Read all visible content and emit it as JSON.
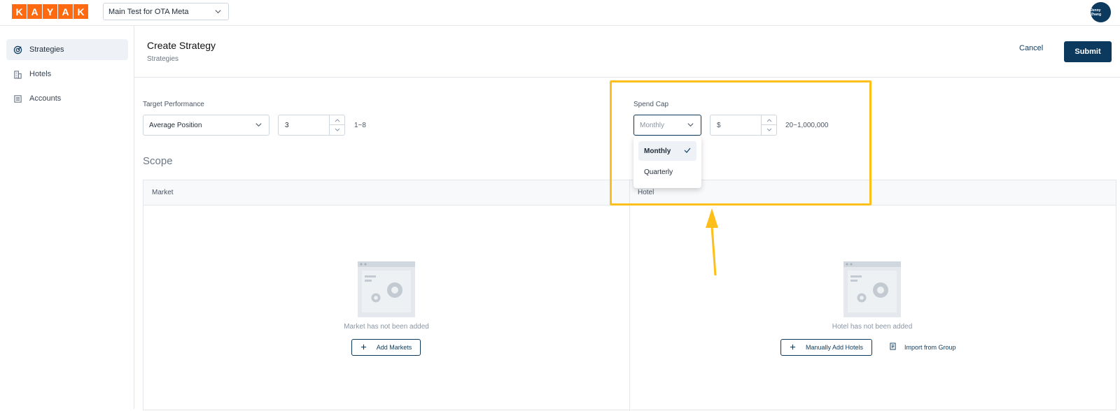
{
  "brand": {
    "letters": [
      "K",
      "A",
      "Y",
      "A",
      "K"
    ],
    "color": "#ff690f"
  },
  "account_selector": {
    "value": "Main Test for OTA Meta"
  },
  "user": {
    "initials": "Jenny Zhang"
  },
  "sidebar": {
    "items": [
      {
        "label": "Strategies",
        "icon": "target-icon",
        "active": true
      },
      {
        "label": "Hotels",
        "icon": "building-icon",
        "active": false
      },
      {
        "label": "Accounts",
        "icon": "ledger-icon",
        "active": false
      }
    ]
  },
  "header": {
    "title": "Create Strategy",
    "breadcrumb": "Strategies",
    "cancel_label": "Cancel",
    "submit_label": "Submit"
  },
  "target_performance": {
    "label": "Target Performance",
    "metric_value": "Average Position",
    "number_value": "3",
    "range_hint": "1~8"
  },
  "spend_cap": {
    "label": "Spend Cap",
    "period_placeholder": "Monthly",
    "currency_symbol": "$",
    "amount_value": "",
    "range_hint": "20~1,000,000",
    "options": [
      {
        "label": "Monthly",
        "selected": true
      },
      {
        "label": "Quarterly",
        "selected": false
      }
    ]
  },
  "scope": {
    "title": "Scope",
    "market": {
      "header": "Market",
      "empty_text": "Market has not been added",
      "add_label": "Add Markets"
    },
    "hotel": {
      "header": "Hotel",
      "empty_text": "Hotel has not been added",
      "add_label": "Manually Add Hotels",
      "import_label": "Import from Group"
    }
  },
  "colors": {
    "primary": "#0b3a5e",
    "highlight": "#ffbf1a",
    "brand": "#ff690f"
  }
}
